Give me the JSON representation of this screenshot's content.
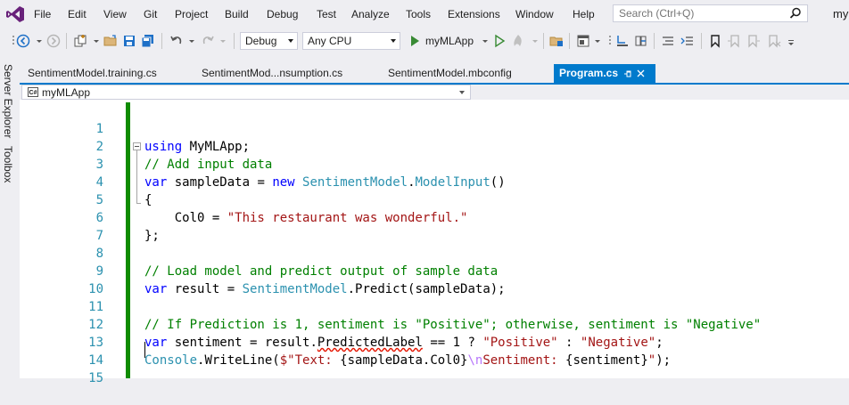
{
  "menubar": {
    "items": [
      "File",
      "Edit",
      "View",
      "Git",
      "Project",
      "Build",
      "Debug",
      "Test",
      "Analyze",
      "Tools",
      "Extensions",
      "Window",
      "Help"
    ],
    "search_placeholder": "Search (Ctrl+Q)",
    "profile": "my"
  },
  "toolbar": {
    "config": "Debug",
    "platform": "Any CPU",
    "run_target": "myMLApp"
  },
  "side_tabs": [
    "Server Explorer",
    "Toolbox"
  ],
  "tabs": [
    {
      "label": "SentimentModel.training.cs",
      "active": false
    },
    {
      "label": "SentimentMod...nsumption.cs",
      "active": false
    },
    {
      "label": "SentimentModel.mbconfig",
      "active": false
    },
    {
      "label": "Program.cs",
      "active": true
    }
  ],
  "navbar": {
    "project": "myMLApp"
  },
  "editor": {
    "line_numbers": [
      "1",
      "2",
      "3",
      "4",
      "5",
      "6",
      "7",
      "8",
      "9",
      "10",
      "11",
      "12",
      "13",
      "14",
      "15"
    ],
    "tokens": {
      "l1_kw": "using",
      "l1_rest": " MyMLApp;",
      "l2_cm": "// Add input data",
      "l3_kw1": "var",
      "l3_a": " sampleData = ",
      "l3_kw2": "new",
      "l3_sp": " ",
      "l3_ty1": "SentimentModel",
      "l3_dot": ".",
      "l3_ty2": "ModelInput",
      "l3_end": "()",
      "l4": "{",
      "l5_a": "    Col0 = ",
      "l5_str": "\"This restaurant was wonderful.\"",
      "l6": "};",
      "l8_cm": "// Load model and predict output of sample data",
      "l9_kw": "var",
      "l9_a": " result = ",
      "l9_ty": "SentimentModel",
      "l9_b": ".Predict(sampleData);",
      "l11_cm": "// If Prediction is 1, sentiment is \"Positive\"; otherwise, sentiment is \"Negative\"",
      "l12_kw": "var",
      "l12_a": " sentiment = result.",
      "l12_sq": "PredictedLabel",
      "l12_b": " == 1 ? ",
      "l12_s1": "\"Positive\"",
      "l12_c": " : ",
      "l12_s2": "\"Negative\"",
      "l12_d": ";",
      "l13_ty": "Console",
      "l13_a": ".WriteLine(",
      "l13_s1": "$\"Text: ",
      "l13_b": "{sampleData.Col0}",
      "l13_esc": "\\n",
      "l13_s2": "Sentiment: ",
      "l13_c": "{sentiment}",
      "l13_s3": "\"",
      "l13_d": ");"
    }
  },
  "colors": {
    "accent": "#007acc",
    "change_bar": "#108c00",
    "line_number": "#2b91af",
    "keyword": "#0000ff",
    "comment": "#008000",
    "type": "#2b91af",
    "string": "#a31515"
  },
  "icons": [
    "visual-studio-logo-icon",
    "search-icon",
    "back-icon",
    "forward-icon",
    "new-project-icon",
    "open-folder-icon",
    "save-icon",
    "save-all-icon",
    "undo-icon",
    "redo-icon",
    "start-icon",
    "start-without-debugging-icon",
    "hot-reload-icon",
    "solution-explorer-icon",
    "bookmark-icon"
  ]
}
